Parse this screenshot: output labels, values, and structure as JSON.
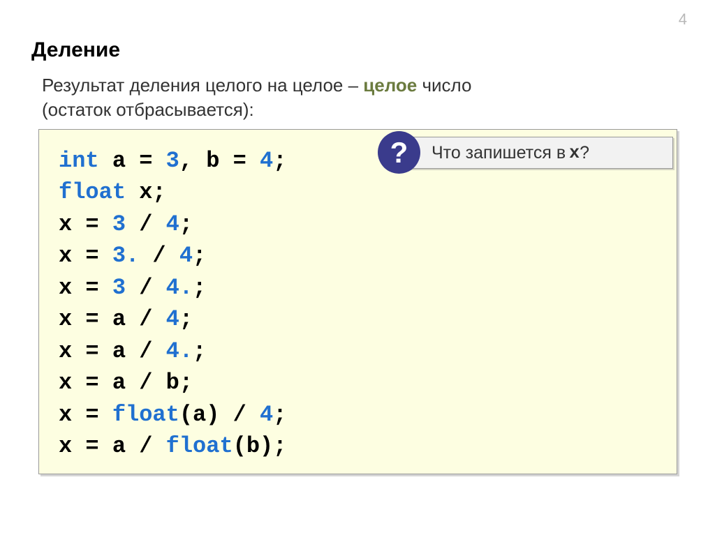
{
  "page_number": "4",
  "title": "Деление",
  "description": {
    "line1_part1": "Результат деления целого на целое – ",
    "line1_highlight": "целое",
    "line1_part2": " число",
    "line2": "(остаток отбрасывается):"
  },
  "code": {
    "line1_kw": "int",
    "line1_rest_a": " a = ",
    "line1_val1": "3",
    "line1_comma": ", b = ",
    "line1_val2": "4",
    "line1_semi": ";",
    "line2_kw": "float",
    "line2_rest": " x;",
    "line3_a": "x = ",
    "line3_v1": "3",
    "line3_b": " / ",
    "line3_v2": "4",
    "line3_c": ";",
    "line4_a": "x = ",
    "line4_v1": "3.",
    "line4_b": " / ",
    "line4_v2": "4",
    "line4_c": ";",
    "line5_a": "x = ",
    "line5_v1": "3",
    "line5_b": " / ",
    "line5_v2": "4.",
    "line5_c": ";",
    "line6_a": "x = a / ",
    "line6_v1": "4",
    "line6_c": ";",
    "line7_a": "x = a / ",
    "line7_v1": "4.",
    "line7_c": ";",
    "line8": "x = a / b;",
    "line9_a": "x = ",
    "line9_fn": "float",
    "line9_b": "(a) / ",
    "line9_v1": "4",
    "line9_c": ";",
    "line10_a": "x = a / ",
    "line10_fn": "float",
    "line10_b": "(b);"
  },
  "callout": {
    "icon": "?",
    "text_a": "Что запишется в ",
    "text_mono": "x",
    "text_b": "?"
  }
}
